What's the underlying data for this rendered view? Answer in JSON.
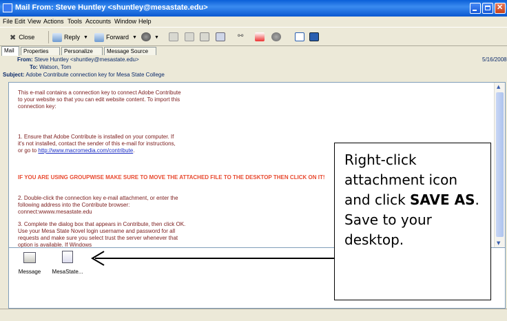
{
  "window": {
    "title": "Mail From: Steve Huntley <shuntley@mesastate.edu>"
  },
  "menu": [
    "File",
    "Edit",
    "View",
    "Actions",
    "Tools",
    "Accounts",
    "Window",
    "Help"
  ],
  "toolbar": {
    "close_label": "Close",
    "reply_label": "Reply",
    "forward_label": "Forward"
  },
  "tabs": [
    "Mail",
    "Properties",
    "Personalize",
    "Message Source"
  ],
  "header": {
    "from_label": "From:",
    "from_value": "Steve Huntley <shuntley@mesastate.edu>",
    "to_label": "To:",
    "to_value": "Watson, Tom",
    "subject_label": "Subject:",
    "subject_value": "Adobe Contribute connection key for Mesa State College",
    "date": "5/16/2008"
  },
  "body": {
    "p1": "This e-mail contains a connection key to connect Adobe Contribute to your website so that you can edit website content. To import this connection key:",
    "p2": "1. Ensure that Adobe Contribute is installed on your computer. If it's not installed, contact the sender of this e-mail for instructions, or go to",
    "p2_link": "http://www.macromedia.com/contribute",
    "p2_end": ".",
    "warning": "IF YOU ARE USING GROUPWISE MAKE SURE TO MOVE THE ATTACHED FILE TO THE DESKTOP THEN CLICK ON IT!",
    "p3": "2. Double-click the connection key e-mail attachment, or enter the following address into the Contribute browser: connect:wwww.mesastate.edu",
    "p4": "3. Complete the dialog box that appears in Contribute, then click OK. Use your Mesa State Novel login username and password for all requests and make sure you select trust the server whenever that option is available. If Windows"
  },
  "attachments": [
    {
      "label": "Message",
      "icon": "envelope-icon"
    },
    {
      "label": "MesaState...",
      "icon": "key-file-icon"
    }
  ],
  "callout": {
    "text_before": "Right-click attachment icon and click ",
    "bold": "SAVE AS",
    "text_after": ". Save to your desktop."
  },
  "colors": {
    "titlebar": "#0a5fd8",
    "warning": "#e8492f",
    "body_text": "#7a1a1a",
    "link": "#1a2cc4"
  }
}
